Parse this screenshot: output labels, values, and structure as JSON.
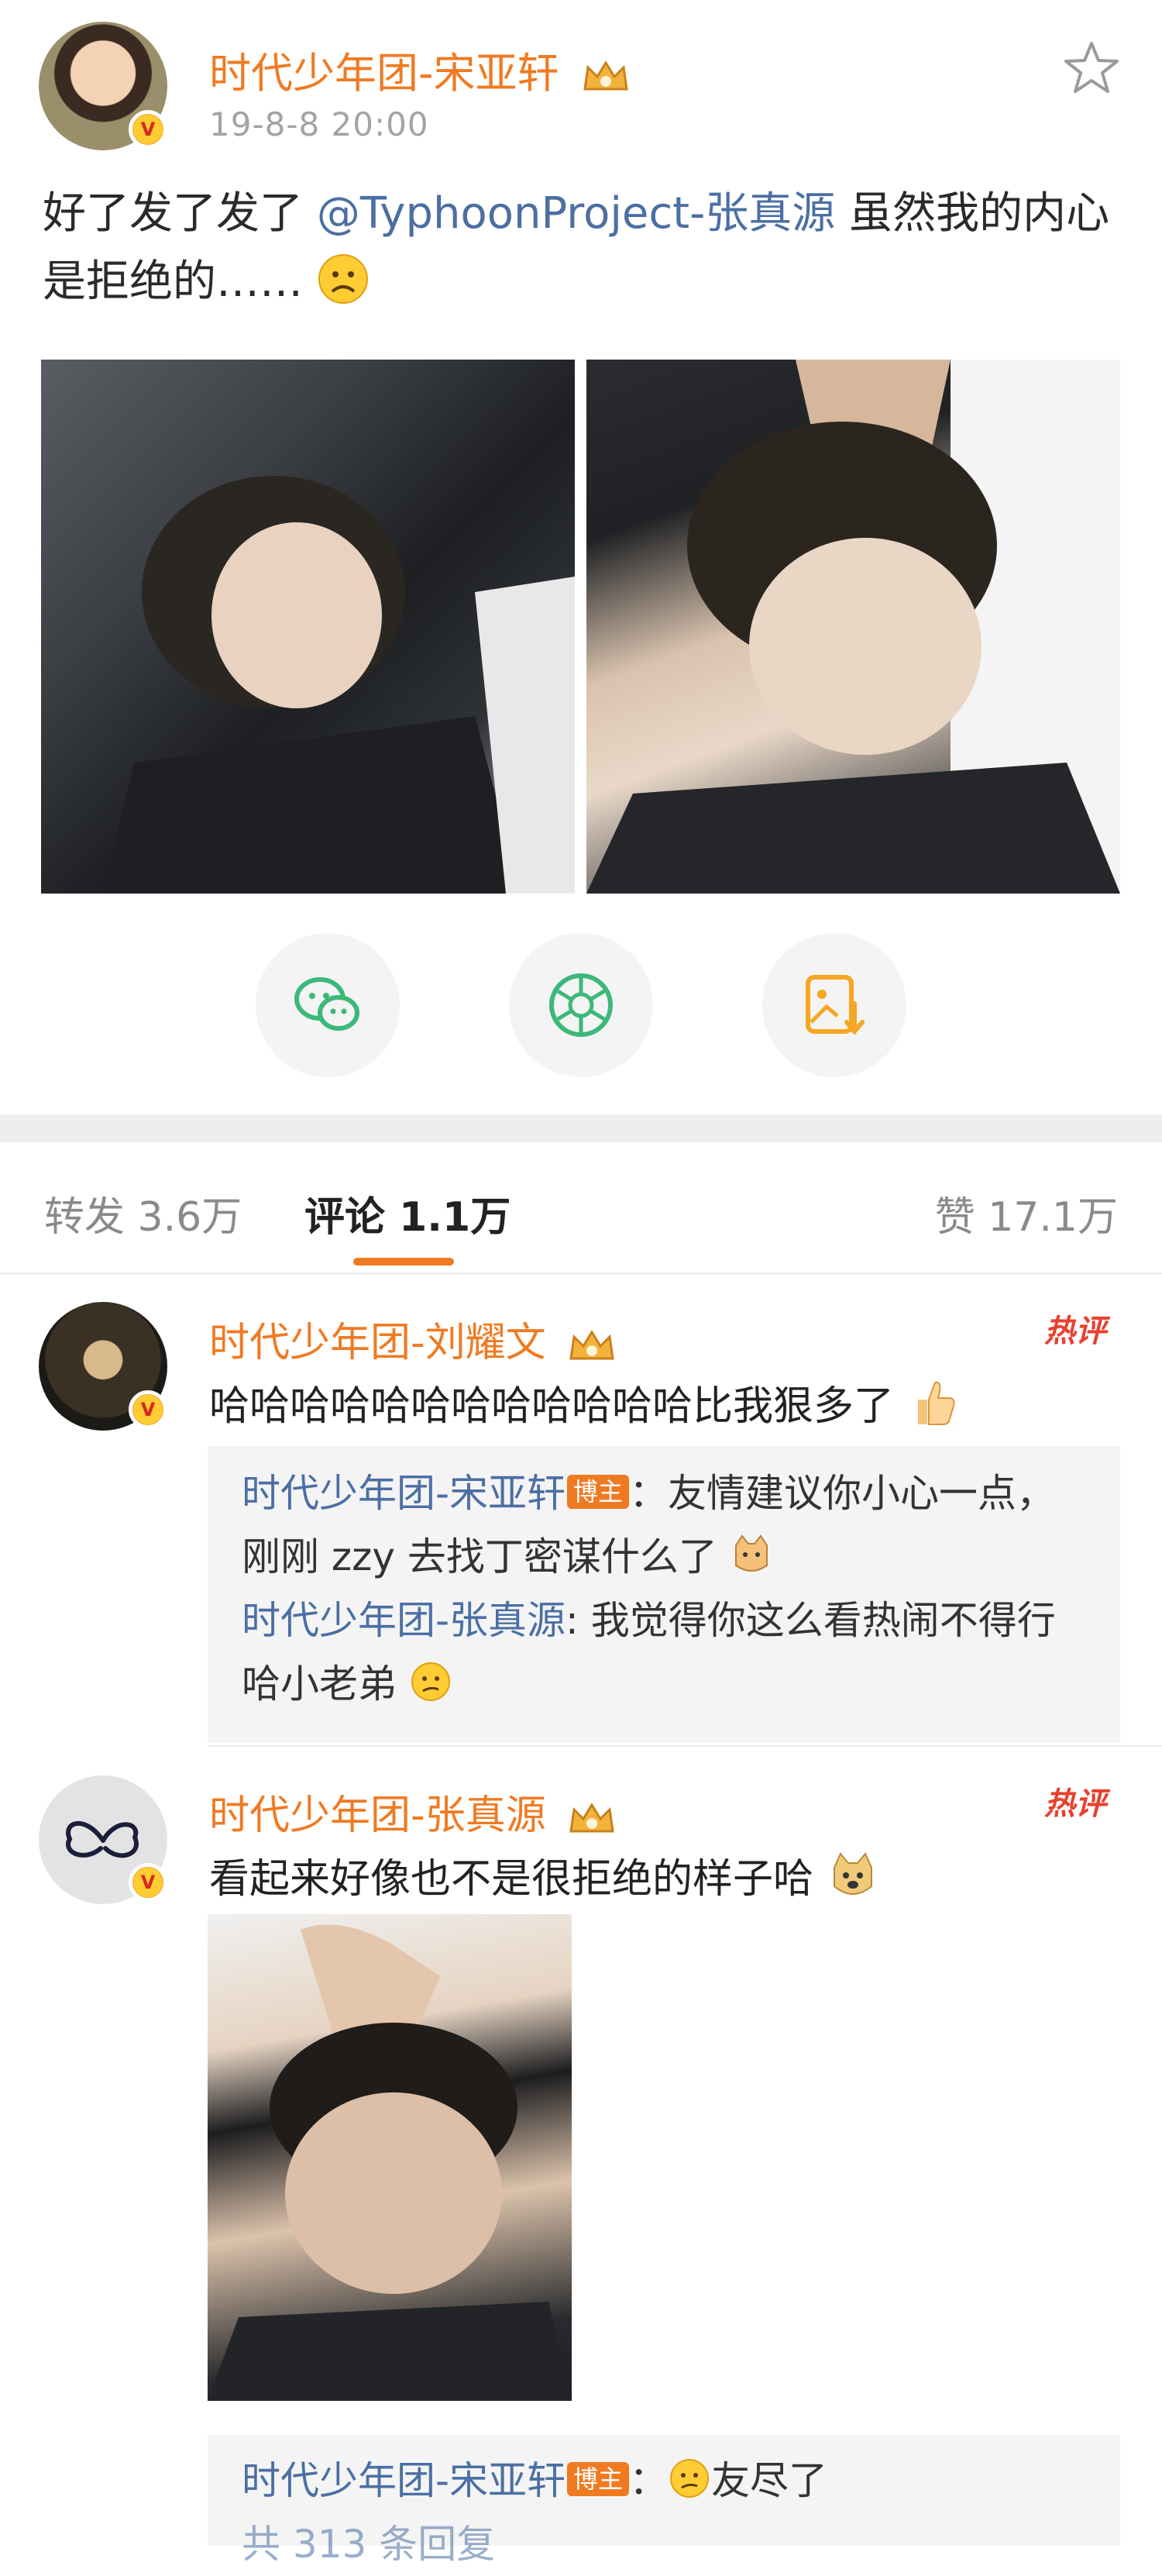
{
  "post": {
    "author": "时代少年团-宋亚轩",
    "time": "19-8-8 20:00",
    "text_before": "好了发了发了 ",
    "mention": "@TyphoonProject-张真源",
    "text_after": " 虽然我的内心是拒绝的……"
  },
  "share": {
    "icons": [
      "wechat-icon",
      "moments-icon",
      "save-image-icon"
    ]
  },
  "tabs": {
    "repost": "转发 3.6万",
    "comment": "评论 1.1万",
    "like": "赞 17.1万"
  },
  "comments": [
    {
      "name": "时代少年团-刘耀文",
      "hot": "热评",
      "text": "哈哈哈哈哈哈哈哈哈哈哈哈比我狠多了",
      "replies": [
        {
          "name": "时代少年团-宋亚轩",
          "tag": "博主",
          "text": "：友情建议你小心一点，刚刚 zzy 去找丁密谋什么了"
        },
        {
          "name": "时代少年团-张真源",
          "text": ": 我觉得你这么看热闹不得行哈小老弟"
        }
      ]
    },
    {
      "name": "时代少年团-张真源",
      "hot": "热评",
      "text": "看起来好像也不是很拒绝的样子哈",
      "replies": [
        {
          "name": "时代少年团-宋亚轩",
          "tag": "博主",
          "text": "：友尽了",
          "more": "共 313 条回复"
        }
      ]
    }
  ],
  "colors": {
    "orange": "#f07a22",
    "link_blue": "#4b6fa3",
    "gray_text": "#a3a3a3"
  }
}
